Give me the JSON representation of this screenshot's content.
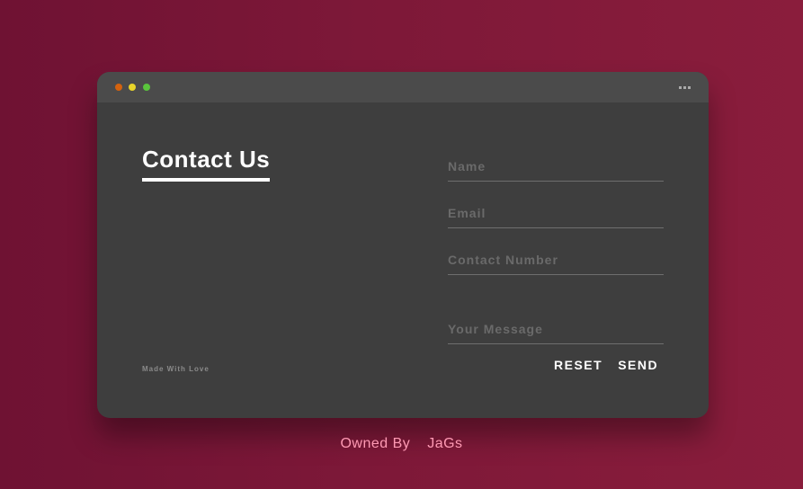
{
  "window": {
    "dots": [
      {
        "name": "close",
        "color": "#d4620e"
      },
      {
        "name": "minimize",
        "color": "#e8d42a"
      },
      {
        "name": "maximize",
        "color": "#5ac43c"
      }
    ],
    "menu_icon": "more-dots-icon"
  },
  "contact": {
    "title": "Contact Us",
    "credit": "Made With Love"
  },
  "form": {
    "name_placeholder": "Name",
    "email_placeholder": "Email",
    "contact_placeholder": "Contact Number",
    "message_placeholder": "Your Message",
    "reset_label": "RESET",
    "send_label": "SEND"
  },
  "footer": {
    "label": "Owned By",
    "owner": "JaGs"
  },
  "colors": {
    "background": "#7d1838",
    "panel": "#3e3e3e",
    "titlebar": "#4b4b4b",
    "footer_text": "#ff9ab4"
  }
}
